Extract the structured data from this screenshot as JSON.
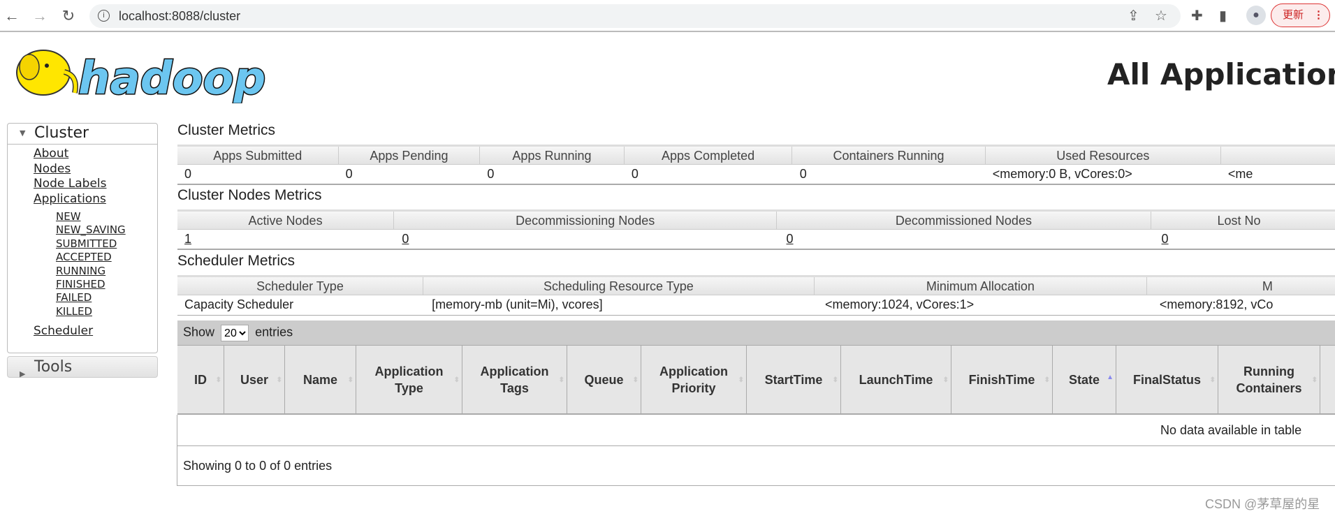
{
  "browser": {
    "url": "localhost:8088/cluster",
    "update_label": "更新"
  },
  "page": {
    "title": "All Applications"
  },
  "sidebar": {
    "cluster_label": "Cluster",
    "tools_label": "Tools",
    "links": [
      "About",
      "Nodes",
      "Node Labels",
      "Applications"
    ],
    "app_states": [
      "NEW",
      "NEW_SAVING",
      "SUBMITTED",
      "ACCEPTED",
      "RUNNING",
      "FINISHED",
      "FAILED",
      "KILLED"
    ],
    "scheduler": "Scheduler"
  },
  "cluster_metrics": {
    "title": "Cluster Metrics",
    "headers": [
      "Apps Submitted",
      "Apps Pending",
      "Apps Running",
      "Apps Completed",
      "Containers Running",
      "Used Resources",
      ""
    ],
    "values": [
      "0",
      "0",
      "0",
      "0",
      "0",
      "<memory:0 B, vCores:0>",
      "<me"
    ]
  },
  "nodes_metrics": {
    "title": "Cluster Nodes Metrics",
    "headers": [
      "Active Nodes",
      "Decommissioning Nodes",
      "Decommissioned Nodes",
      "Lost No"
    ],
    "values": [
      "1",
      "0",
      "0",
      "0"
    ]
  },
  "scheduler_metrics": {
    "title": "Scheduler Metrics",
    "headers": [
      "Scheduler Type",
      "Scheduling Resource Type",
      "Minimum Allocation",
      "M"
    ],
    "values": [
      "Capacity Scheduler",
      "[memory-mb (unit=Mi), vcores]",
      "<memory:1024, vCores:1>",
      "<memory:8192, vCo"
    ]
  },
  "apps_table": {
    "show_label": "Show",
    "entries_label": "entries",
    "page_size": "20",
    "columns": [
      "ID",
      "User",
      "Name",
      "Application Type",
      "Application Tags",
      "Queue",
      "Application Priority",
      "StartTime",
      "LaunchTime",
      "FinishTime",
      "State",
      "FinalStatus",
      "Running Containers"
    ],
    "sorted_column": "State",
    "sort_direction": "ascending",
    "empty_message": "No data available in table",
    "info": "Showing 0 to 0 of 0 entries"
  },
  "watermark": "CSDN @茅草屋的星"
}
